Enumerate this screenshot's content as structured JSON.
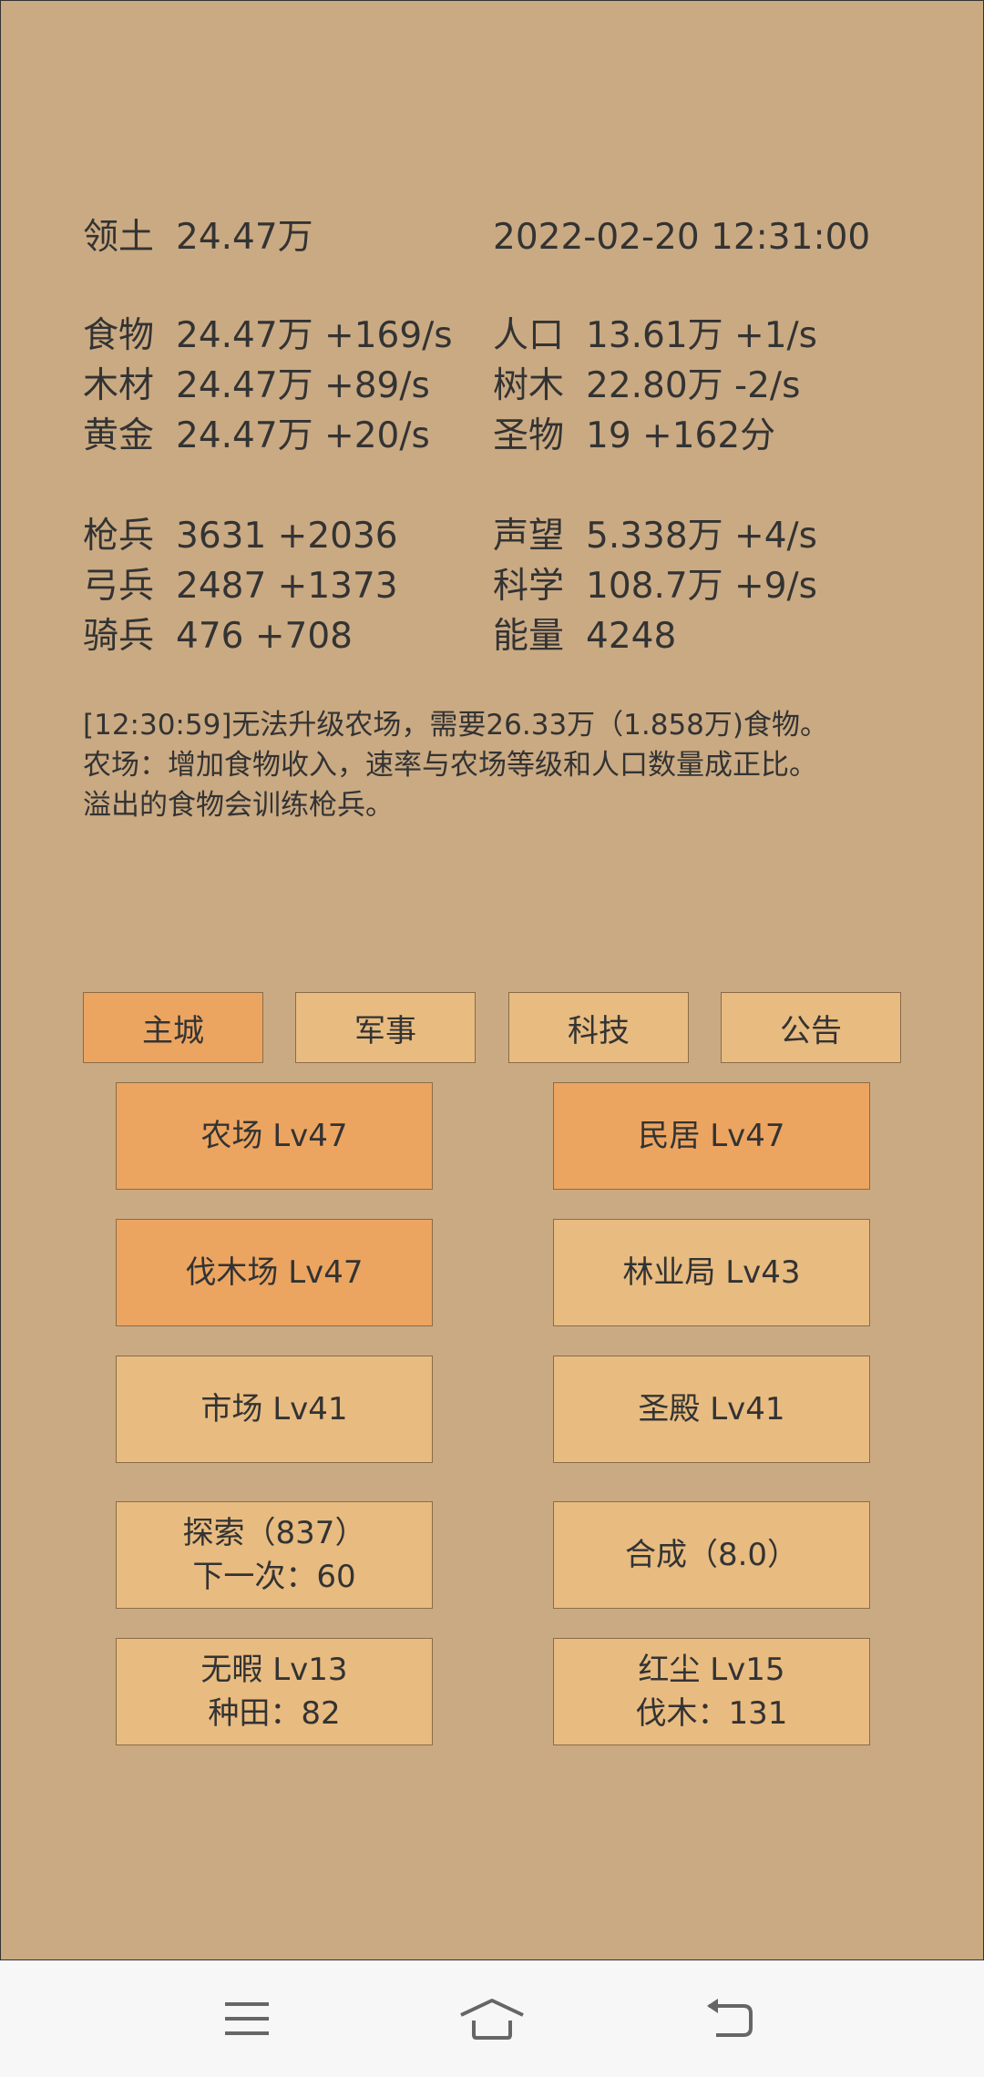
{
  "status": {
    "territory": {
      "label": "领土",
      "value": "24.47万"
    },
    "datetime": "2022-02-20 12:31:00",
    "resources_left": [
      {
        "label": "食物",
        "value": "24.47万 +169/s"
      },
      {
        "label": "木材",
        "value": "24.47万 +89/s"
      },
      {
        "label": "黄金",
        "value": "24.47万 +20/s"
      }
    ],
    "resources_right": [
      {
        "label": "人口",
        "value": "13.61万 +1/s"
      },
      {
        "label": "树木",
        "value": "22.80万 -2/s"
      },
      {
        "label": "圣物",
        "value": "19 +162分"
      }
    ],
    "military_left": [
      {
        "label": "枪兵",
        "value": "3631 +2036"
      },
      {
        "label": "弓兵",
        "value": "2487 +1373"
      },
      {
        "label": "骑兵",
        "value": "476 +708"
      }
    ],
    "military_right": [
      {
        "label": "声望",
        "value": "5.338万 +4/s"
      },
      {
        "label": "科学",
        "value": "108.7万 +9/s"
      },
      {
        "label": "能量",
        "value": "4248"
      }
    ]
  },
  "message": {
    "lines": [
      "[12:30:59]无法升级农场，需要26.33万（1.858万)食物。",
      "农场：增加食物收入，速率与农场等级和人口数量成正比。",
      "溢出的食物会训练枪兵。"
    ]
  },
  "tabs": [
    {
      "label": "主城",
      "active": true
    },
    {
      "label": "军事",
      "active": false
    },
    {
      "label": "科技",
      "active": false
    },
    {
      "label": "公告",
      "active": false
    }
  ],
  "buildings": [
    {
      "line1": "农场 Lv47",
      "line2": "",
      "highlight": true
    },
    {
      "line1": "民居 Lv47",
      "line2": "",
      "highlight": true
    },
    {
      "line1": "伐木场 Lv47",
      "line2": "",
      "highlight": true
    },
    {
      "line1": "林业局 Lv43",
      "line2": "",
      "highlight": false
    },
    {
      "line1": "市场 Lv41",
      "line2": "",
      "highlight": false
    },
    {
      "line1": "圣殿 Lv41",
      "line2": "",
      "highlight": false
    },
    {
      "line1": "探索（837）",
      "line2": "下一次：60",
      "highlight": false
    },
    {
      "line1": "合成（8.0）",
      "line2": "",
      "highlight": false
    },
    {
      "line1": "无暇 Lv13",
      "line2": "种田：82",
      "highlight": false
    },
    {
      "line1": "红尘 Lv15",
      "line2": "伐木：131",
      "highlight": false
    }
  ],
  "colors": {
    "background": "#caaa83",
    "button": "#e8bb80",
    "button_active": "#eba561",
    "text": "#333333",
    "navbar": "#f7f7f7",
    "nav_icon": "#666666"
  },
  "navbar": {
    "icons": [
      "menu-icon",
      "home-icon",
      "back-icon"
    ]
  }
}
